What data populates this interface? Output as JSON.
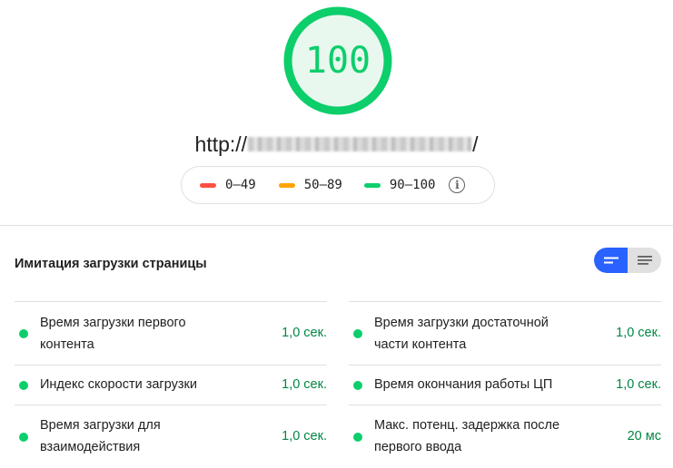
{
  "score": {
    "value": "100",
    "color": "#0cce6b",
    "bg": "#e8f8ee"
  },
  "url": {
    "prefix": "http://",
    "suffix": "/"
  },
  "legend": {
    "items": [
      {
        "label": "0–49",
        "color": "#ff4e42"
      },
      {
        "label": "50–89",
        "color": "#ffa400"
      },
      {
        "label": "90–100",
        "color": "#0cce6b"
      }
    ],
    "info_glyph": "i"
  },
  "section": {
    "title": "Имитация загрузки страницы"
  },
  "metrics": {
    "left": [
      {
        "label": "Время загрузки первого контента",
        "value": "1,0 сек."
      },
      {
        "label": "Индекс скорости загрузки",
        "value": "1,0 сек."
      },
      {
        "label": "Время загрузки для взаимодействия",
        "value": "1,0 сек."
      }
    ],
    "right": [
      {
        "label": "Время загрузки достаточной части контента",
        "value": "1,0 сек."
      },
      {
        "label": "Время окончания работы ЦП",
        "value": "1,0 сек."
      },
      {
        "label": "Макс. потенц. задержка после первого ввода",
        "value": "20 мс"
      }
    ]
  }
}
